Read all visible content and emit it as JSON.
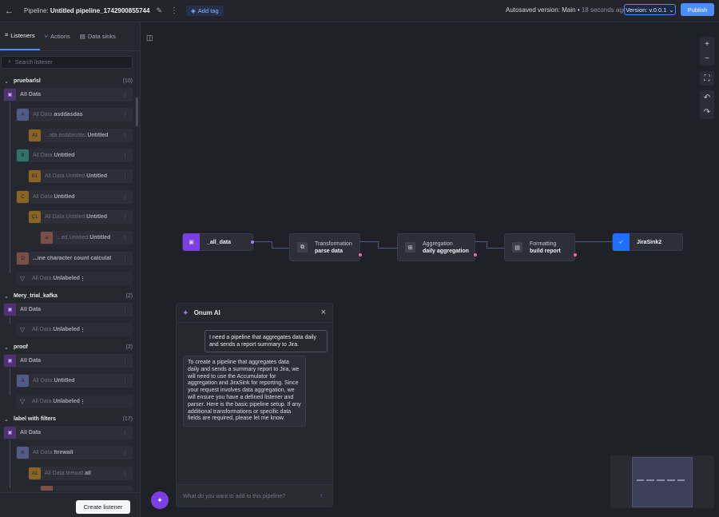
{
  "topbar": {
    "pipeline_prefix": "Pipeline:",
    "pipeline_name": "Untitled pipeline_1742900855744",
    "add_tag": "Add tag",
    "autosaved": "Autosaved version: Main",
    "autosaved_ago": "18 seconds ago",
    "version": "Version: v.0.0.1",
    "publish": "Publish"
  },
  "sidebar": {
    "tabs": [
      "Listeners",
      "Actions",
      "Data sinks"
    ],
    "search_placeholder": "Search listener",
    "create_listener": "Create listener",
    "groups": [
      {
        "name": "pruebarlsl",
        "count": "(10)"
      },
      {
        "name": "Mery_trial_kafka",
        "count": "(2)"
      },
      {
        "name": "proof",
        "count": "(3)"
      },
      {
        "name": "label with filters",
        "count": "(17)"
      }
    ],
    "nodes": [
      {
        "badge": "",
        "prefix": "",
        "bold": "All Data"
      },
      {
        "badge": "A",
        "prefix": "All Data.",
        "bold": "asddasdas"
      },
      {
        "badge": "A1",
        "prefix": "...ata.asddasdas.",
        "bold": "Untitled"
      },
      {
        "badge": "B",
        "prefix": "All Data.",
        "bold": "Untitled"
      },
      {
        "badge": "B1",
        "prefix": "All Data.Untitled.",
        "bold": "Untitled"
      },
      {
        "badge": "C",
        "prefix": "All Data.",
        "bold": "Untitled"
      },
      {
        "badge": "C1",
        "prefix": "All Data.Untitled.",
        "bold": "Untitled"
      },
      {
        "badge": "a",
        "prefix": "...ed.Untitled.",
        "bold": "Untitled"
      },
      {
        "badge": "D",
        "prefix": "",
        "bold": "...ine character count calculat"
      },
      {
        "badge": "",
        "prefix": "All Data.",
        "bold": "Unlabeled"
      },
      {
        "badge": "",
        "prefix": "",
        "bold": "All Data"
      },
      {
        "badge": "",
        "prefix": "All Data.",
        "bold": "Unlabeled"
      },
      {
        "badge": "",
        "prefix": "",
        "bold": "All Data"
      },
      {
        "badge": "A",
        "prefix": "All Data.",
        "bold": "Untitled"
      },
      {
        "badge": "",
        "prefix": "All Data.",
        "bold": "Unlabeled"
      },
      {
        "badge": "",
        "prefix": "",
        "bold": "All Data"
      },
      {
        "badge": "A",
        "prefix": "All Data.",
        "bold": "firewall"
      },
      {
        "badge": "A1",
        "prefix": "All Data.firewall.",
        "bold": "all"
      }
    ]
  },
  "flow": {
    "nodes": [
      {
        "type": "",
        "name": "_all_data"
      },
      {
        "type": "Transformation",
        "name": "parse data"
      },
      {
        "type": "Aggregation",
        "name": "daily aggregation"
      },
      {
        "type": "Formatting",
        "name": "build report"
      },
      {
        "type": "",
        "name": "JiraSink2"
      }
    ]
  },
  "ai": {
    "title": "Onum AI",
    "user_message": "I need a pipeline that aggregates data daily and sends a report summary to Jira.",
    "bot_message": "To create a pipeline that aggregates data daily and sends a summary report to Jira, we will need to use the Accumulator for aggregation and JiraSink for reporting. Since your request involves data aggregation, we will ensure you have a defined listener and parser. Here is the basic pipeline setup. If any additional transformations or specific data fields are required, please let me know.",
    "input_placeholder": "What do you want to add to this pipeline?"
  },
  "colors": {
    "accent": "#4d8dff",
    "listener": "#7b3fe4",
    "sink": "#1f6fff",
    "port_pink": "#f06aa0"
  }
}
